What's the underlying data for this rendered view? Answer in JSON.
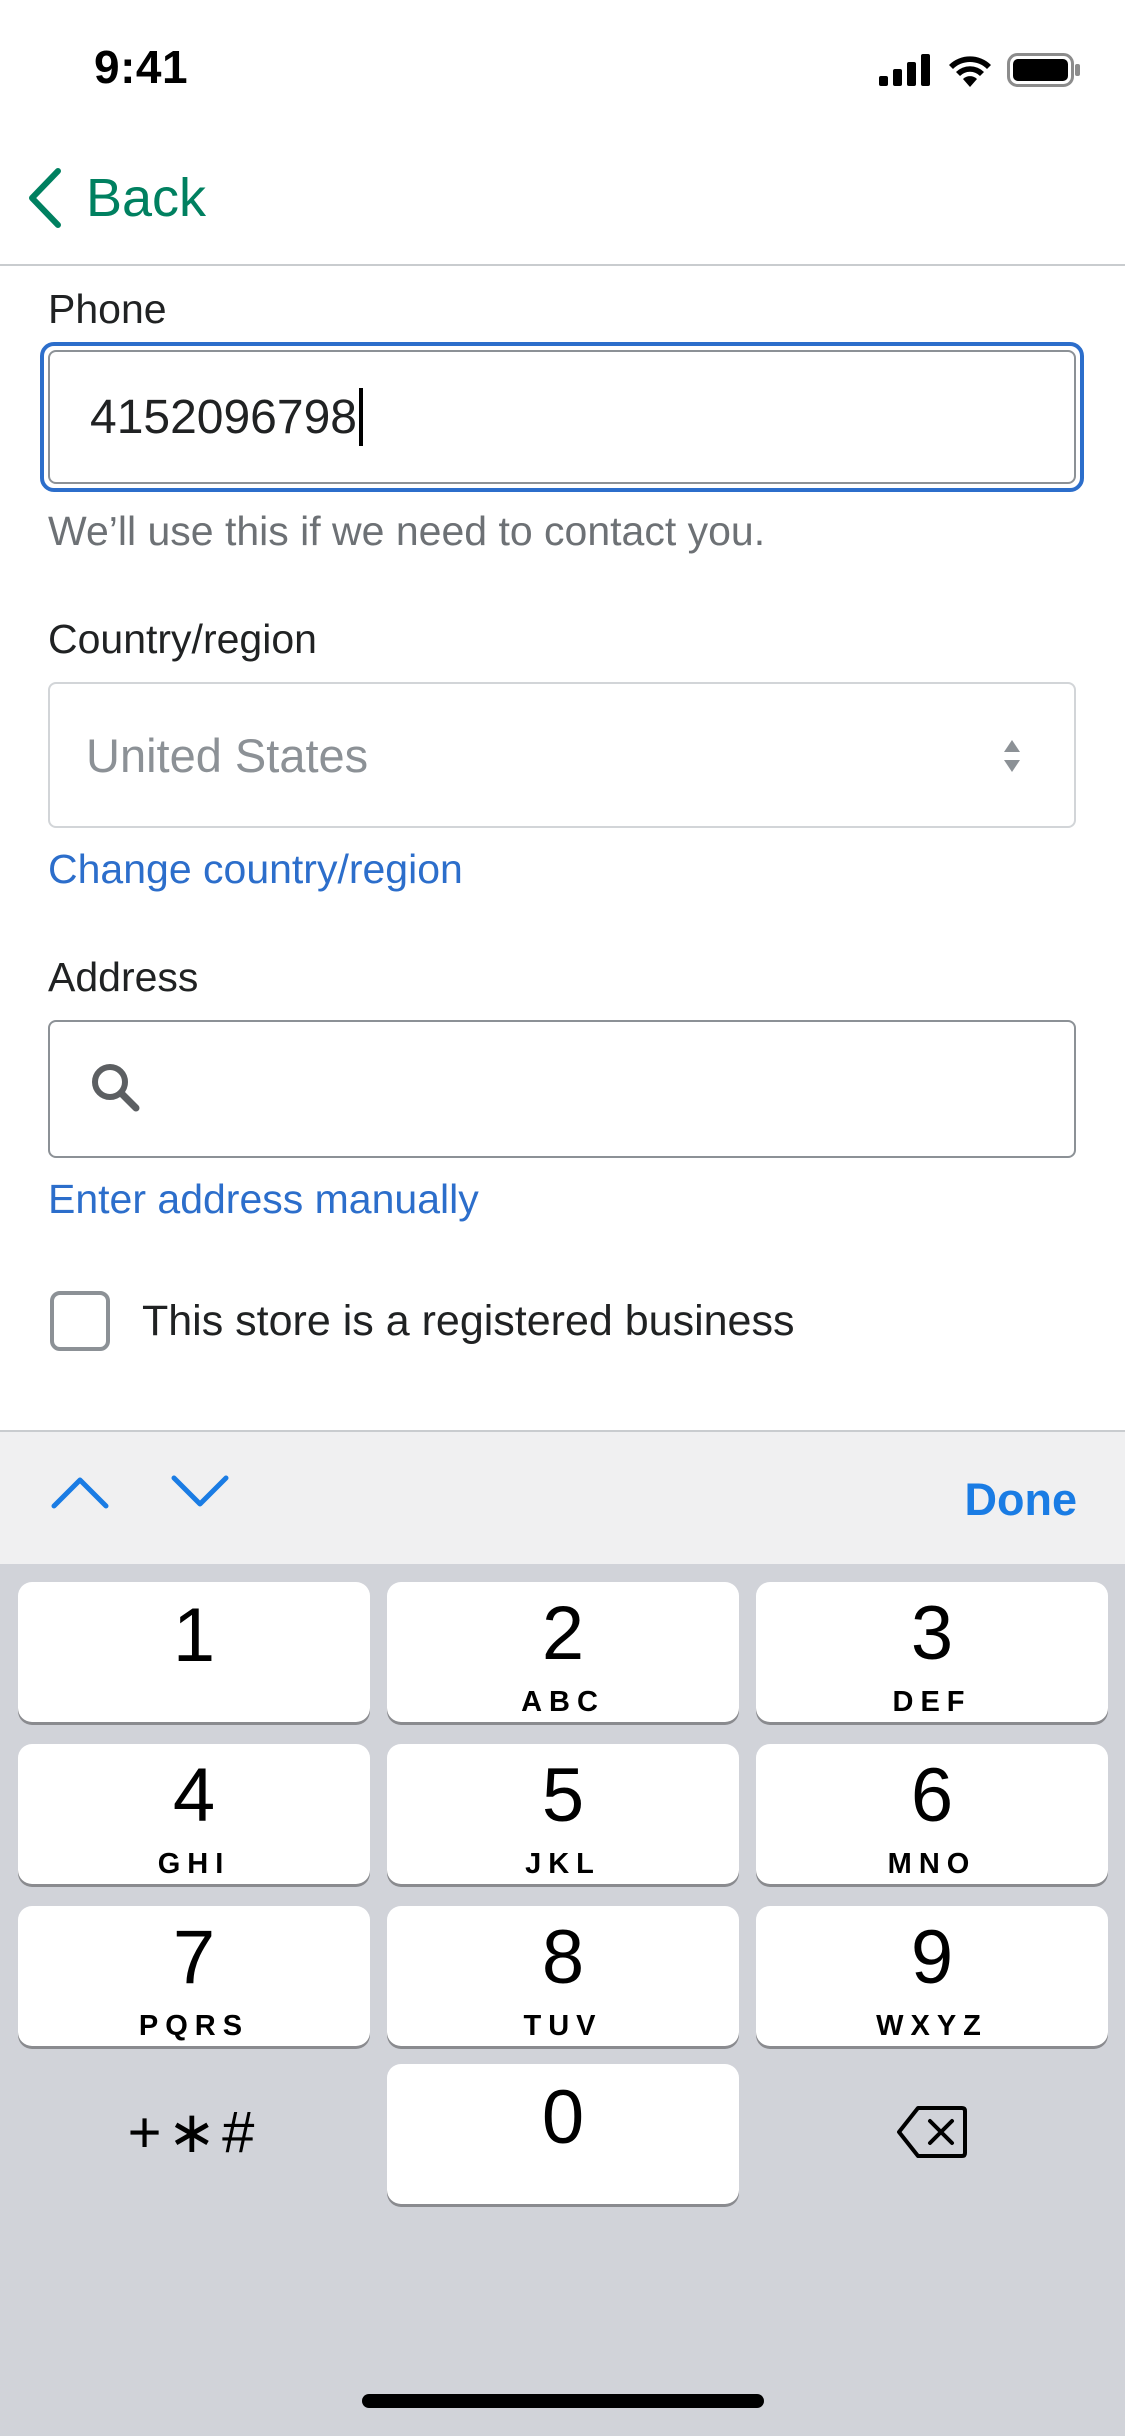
{
  "status_bar": {
    "time": "9:41",
    "icons": [
      "cellular-signal-icon",
      "wifi-icon",
      "battery-icon"
    ]
  },
  "nav": {
    "back_label": "Back",
    "accent_color": "#008060"
  },
  "form": {
    "phone": {
      "label": "Phone",
      "value": "4152096798",
      "help": "We’ll use this if we need to contact you."
    },
    "country": {
      "label": "Country/region",
      "selected": "United States",
      "change_link": "Change country/region"
    },
    "address": {
      "label": "Address",
      "value": "",
      "manual_link": "Enter address manually"
    },
    "registered_business": {
      "label": "This store is a registered business",
      "checked": false
    }
  },
  "keyboard": {
    "accessory": {
      "done_label": "Done"
    },
    "keys": [
      {
        "digit": "1",
        "letters": ""
      },
      {
        "digit": "2",
        "letters": "ABC"
      },
      {
        "digit": "3",
        "letters": "DEF"
      },
      {
        "digit": "4",
        "letters": "GHI"
      },
      {
        "digit": "5",
        "letters": "JKL"
      },
      {
        "digit": "6",
        "letters": "MNO"
      },
      {
        "digit": "7",
        "letters": "PQRS"
      },
      {
        "digit": "8",
        "letters": "TUV"
      },
      {
        "digit": "9",
        "letters": "WXYZ"
      },
      {
        "digit": "0",
        "letters": ""
      }
    ],
    "symbols_label": "+∗#"
  },
  "colors": {
    "link": "#2c6ecb",
    "focus": "#2c6ecb",
    "done": "#1a7ce4",
    "keypad_bg": "#d1d3d9"
  }
}
